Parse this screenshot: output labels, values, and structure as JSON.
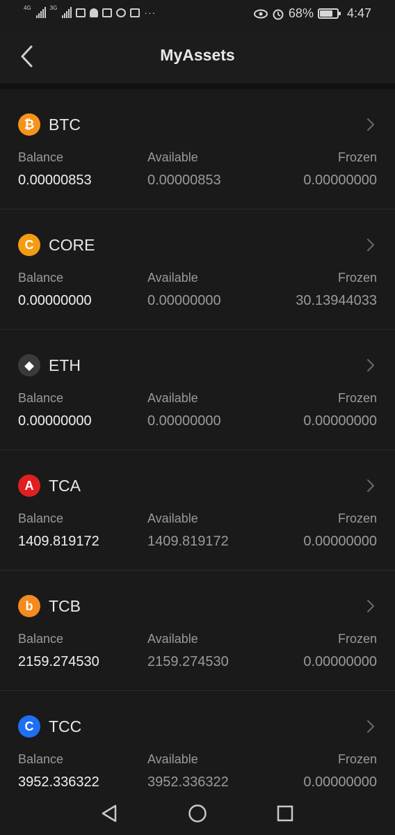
{
  "status_bar": {
    "network_1": "4G",
    "network_2": "3G",
    "battery_percent": "68%",
    "battery_level": 0.68,
    "time": "4:47",
    "more": "···"
  },
  "header": {
    "title": "MyAssets"
  },
  "labels": {
    "balance": "Balance",
    "available": "Available",
    "frozen": "Frozen"
  },
  "assets": [
    {
      "symbol": "BTC",
      "icon": "bitcoin-icon",
      "icon_glyph": "₿",
      "color": "#f7931a",
      "balance": "0.00000853",
      "available": "0.00000853",
      "frozen": "0.00000000"
    },
    {
      "symbol": "CORE",
      "icon": "core-icon",
      "icon_glyph": "C",
      "color": "#f39c12",
      "balance": "0.00000000",
      "available": "0.00000000",
      "frozen": "30.13944033"
    },
    {
      "symbol": "ETH",
      "icon": "ethereum-icon",
      "icon_glyph": "◆",
      "color": "#3a3a3a",
      "balance": "0.00000000",
      "available": "0.00000000",
      "frozen": "0.00000000"
    },
    {
      "symbol": "TCA",
      "icon": "tca-icon",
      "icon_glyph": "A",
      "color": "#e02020",
      "balance": "1409.819172",
      "available": "1409.819172",
      "frozen": "0.00000000"
    },
    {
      "symbol": "TCB",
      "icon": "tcb-icon",
      "icon_glyph": "b",
      "color": "#f58a1f",
      "balance": "2159.274530",
      "available": "2159.274530",
      "frozen": "0.00000000"
    },
    {
      "symbol": "TCC",
      "icon": "tcc-icon",
      "icon_glyph": "C",
      "color": "#1e6ff2",
      "balance": "3952.336322",
      "available": "3952.336322",
      "frozen": "0.00000000"
    }
  ],
  "nav": {
    "back": "back-icon",
    "home": "home-icon",
    "recents": "recents-icon"
  }
}
